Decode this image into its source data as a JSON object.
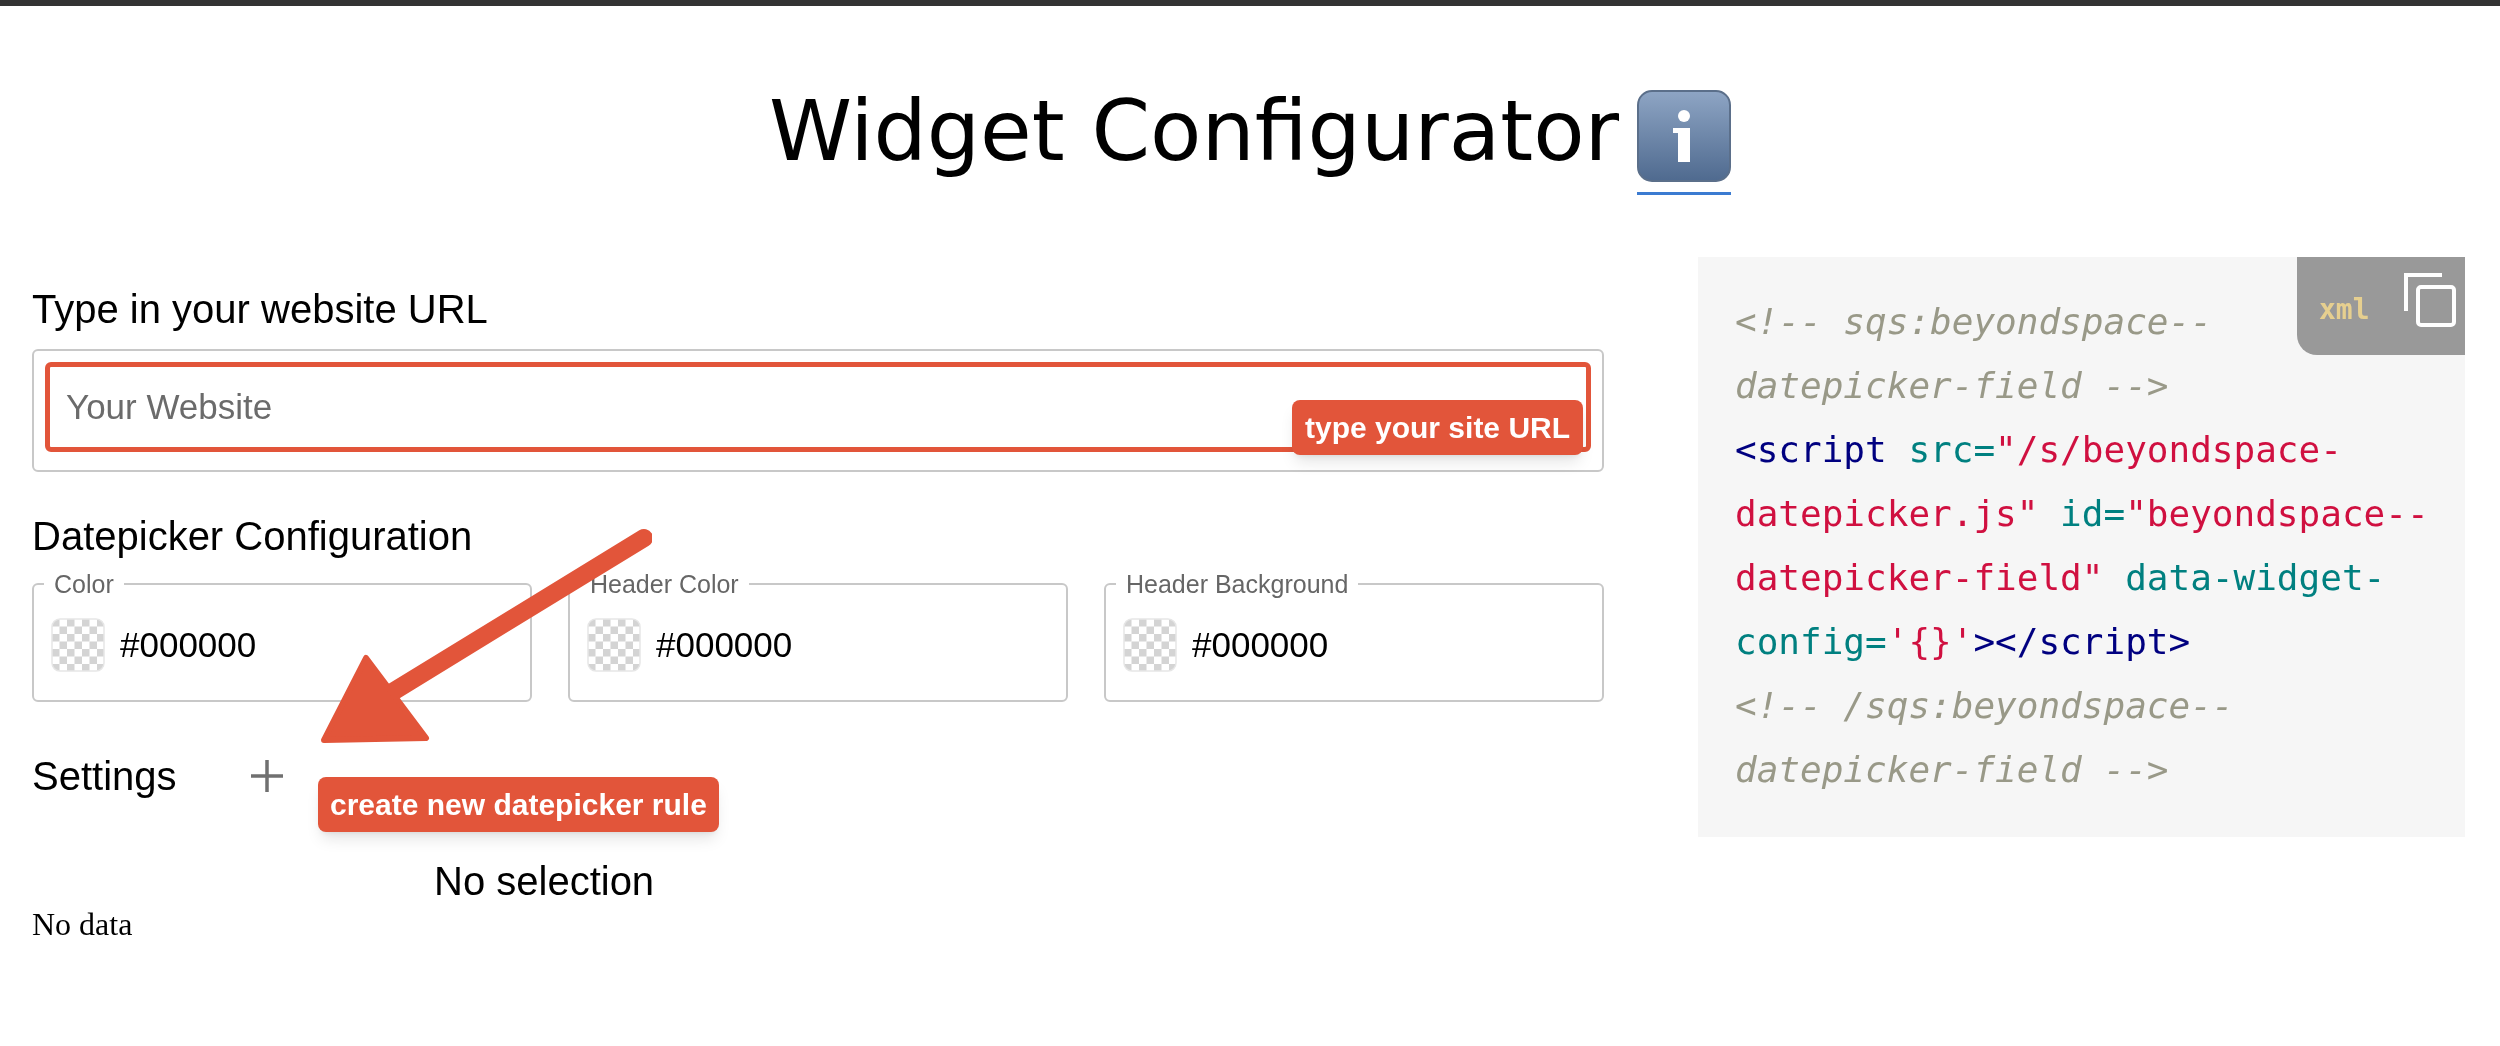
{
  "title": "Widget Configurator",
  "url_section": {
    "heading": "Type in your website URL",
    "input": {
      "placeholder": "Your Website"
    },
    "callout": "type your site URL"
  },
  "datepicker": {
    "heading": "Datepicker Configuration",
    "fields": [
      {
        "label": "Color",
        "value": "#000000"
      },
      {
        "label": "Header Color",
        "value": "#000000"
      },
      {
        "label": "Header Background",
        "value": "#000000"
      }
    ]
  },
  "settings": {
    "heading": "Settings",
    "callout": "create new datepicker rule",
    "empty_selection": "No selection",
    "empty_data": "No data"
  },
  "code": {
    "language": "xml",
    "lines": [
      [
        {
          "kind": "comment",
          "text": "<!-- sqs:beyondspace--"
        }
      ],
      [
        {
          "kind": "comment",
          "text": "datepicker-field -->"
        }
      ],
      [
        {
          "kind": "tag",
          "text": "<script"
        },
        {
          "kind": "attr",
          "text": " src="
        },
        {
          "kind": "string",
          "text": "\"/s/beyondspace-"
        }
      ],
      [
        {
          "kind": "string",
          "text": "datepicker.js\""
        },
        {
          "kind": "attr",
          "text": " id="
        },
        {
          "kind": "string",
          "text": "\"beyondspace--"
        }
      ],
      [
        {
          "kind": "string",
          "text": "datepicker-field\""
        },
        {
          "kind": "attr",
          "text": " data-widget-"
        }
      ],
      [
        {
          "kind": "attr",
          "text": "config="
        },
        {
          "kind": "string",
          "text": "'{}'"
        },
        {
          "kind": "tag",
          "text": "></script>"
        }
      ],
      [
        {
          "kind": "comment",
          "text": "<!-- /sqs:beyondspace--"
        }
      ],
      [
        {
          "kind": "comment",
          "text": "datepicker-field -->"
        }
      ]
    ]
  }
}
